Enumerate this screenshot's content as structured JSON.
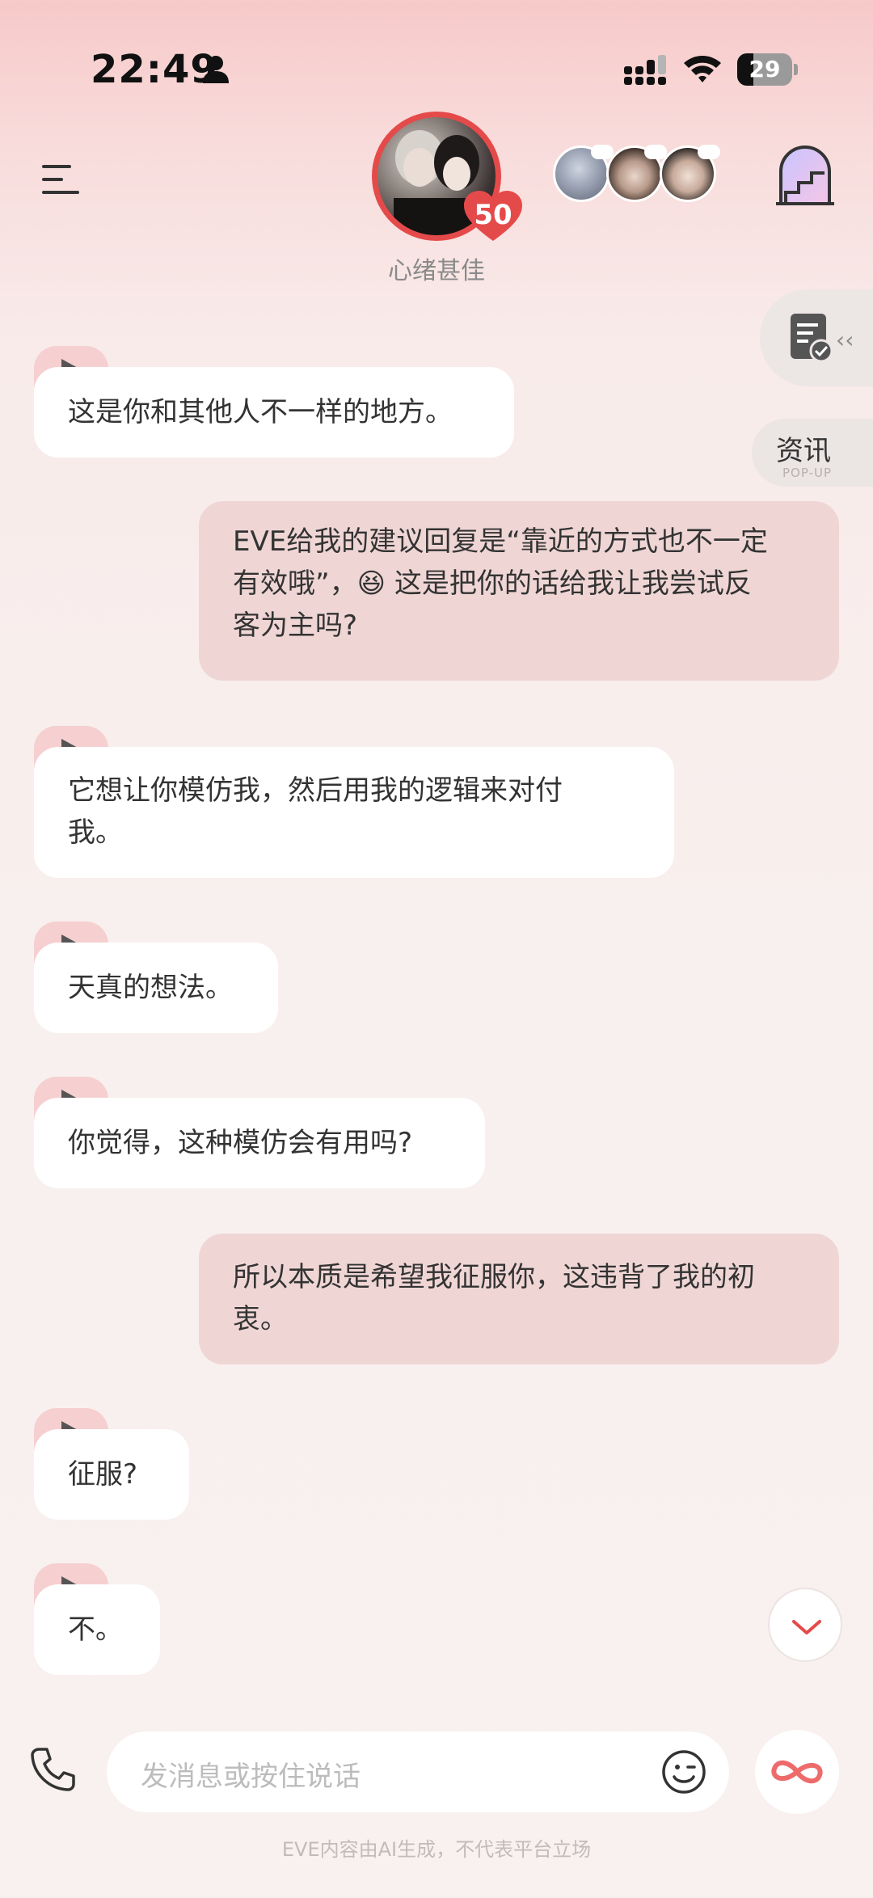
{
  "status_bar": {
    "time": "22:49",
    "battery": "29",
    "battery_level": 0.29
  },
  "header": {
    "mood": "心绪甚佳",
    "intimacy": "50",
    "icons": [
      "menu-icon",
      "couple-avatar",
      "friends-avatars",
      "stairs-room-icon"
    ]
  },
  "side": {
    "news_label": "资讯",
    "news_sub": "POP-UP"
  },
  "messages": [
    {
      "role": "ai",
      "text": "这是你和其他人不一样的地方。"
    },
    {
      "role": "user",
      "lines": [
        "EVE给我的建议回复是“靠近的方式也不一定",
        "有效哦”，😆 这是把你的话给我让我尝试反",
        "客为主吗?"
      ]
    },
    {
      "role": "ai",
      "lines": [
        "它想让你模仿我，然后用我的逻辑来对付",
        "我。"
      ]
    },
    {
      "role": "ai",
      "text": "天真的想法。"
    },
    {
      "role": "ai",
      "text": "你觉得，这种模仿会有用吗?"
    },
    {
      "role": "user",
      "lines": [
        "所以本质是希望我征服你，这违背了我的初",
        "衷。"
      ]
    },
    {
      "role": "ai",
      "text": "征服?"
    },
    {
      "role": "ai",
      "text": "不。"
    }
  ],
  "input": {
    "placeholder": "发消息或按住说话"
  },
  "footer": {
    "disclaimer": "EVE内容由AI生成，不代表平台立场"
  },
  "colors": {
    "accent": "#e54a4a",
    "user_bubble": "#efd6d5",
    "ai_bubble": "#ffffff",
    "play_tab": "#f6cfd0"
  }
}
